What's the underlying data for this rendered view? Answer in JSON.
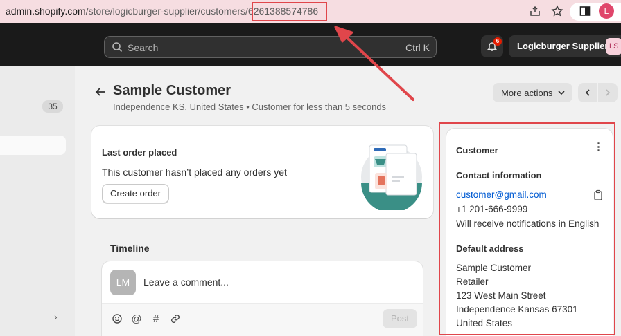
{
  "browser": {
    "url_domain": "admin.shopify.com",
    "url_path": "/store/logicburger-supplier/customers/",
    "url_id": "6261388574786",
    "profile_initial": "L"
  },
  "topbar": {
    "search_placeholder": "Search",
    "search_shortcut": "Ctrl K",
    "notification_count": "6",
    "store_name": "Logicburger Supplier",
    "store_initials": "LS"
  },
  "sidebar": {
    "count_badge": "35"
  },
  "header": {
    "title": "Sample Customer",
    "subtitle": "Independence KS, United States • Customer for less than 5 seconds",
    "more_actions_label": "More actions"
  },
  "order_card": {
    "title": "Last order placed",
    "text": "This customer hasn’t placed any orders yet",
    "button_label": "Create order"
  },
  "timeline": {
    "title": "Timeline",
    "avatar_initials": "LM",
    "comment_placeholder": "Leave a comment...",
    "post_label": "Post"
  },
  "customer_card": {
    "title": "Customer",
    "contact_heading": "Contact information",
    "email": "customer@gmail.com",
    "phone": "+1 201-666-9999",
    "notifications": "Will receive notifications in English",
    "address_heading": "Default address",
    "address_lines": [
      "Sample Customer",
      "Retailer",
      "123 West Main Street",
      "Independence Kansas 67301",
      "United States"
    ]
  },
  "colors": {
    "annotation": "#e0464b",
    "link": "#005bd3",
    "topbar": "#1a1a1a"
  }
}
